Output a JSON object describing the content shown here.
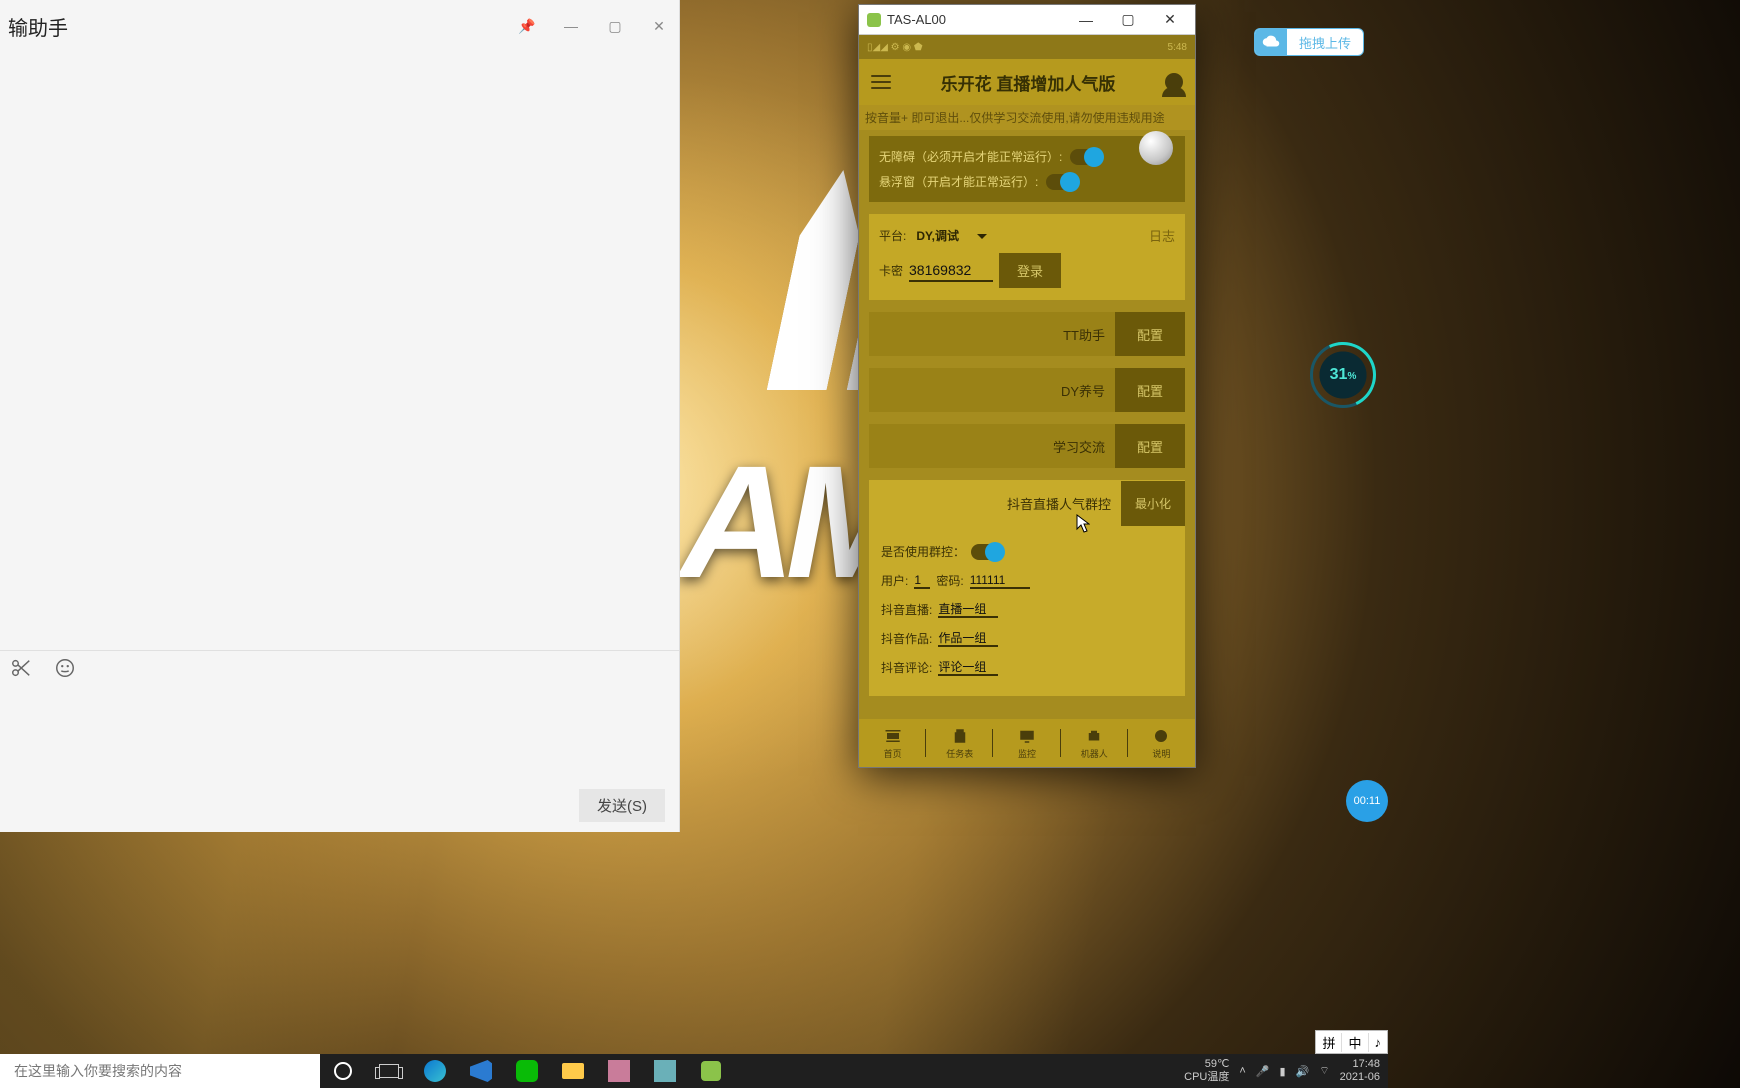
{
  "chat": {
    "title": "输助手",
    "send": "发送(S)"
  },
  "emu": {
    "title": "TAS-AL00",
    "status_time": "5:48",
    "app_title": "乐开花 直播增加人气版",
    "marquee": "按音量+ 即可退出...仅供学习交流使用,请勿使用违规用途",
    "toggle_accessibility": "无障碍（必须开启才能正常运行）:",
    "toggle_float": "悬浮窗（开启才能正常运行）:",
    "platform_label": "平台:",
    "platform_value": "DY,调试",
    "log_link": "日志",
    "card_label": "卡密",
    "card_value": "38169832",
    "login_btn": "登录",
    "rows": [
      {
        "label": "TT助手",
        "btn": "配置"
      },
      {
        "label": "DY养号",
        "btn": "配置"
      },
      {
        "label": "学习交流",
        "btn": "配置"
      }
    ],
    "section_title": "抖音直播人气群控",
    "minimize": "最小化",
    "use_group_label": "是否使用群控：",
    "user_label": "用户:",
    "user_value": "1",
    "pass_label": "密码:",
    "pass_value": "111111",
    "dy_live_label": "抖音直播:",
    "dy_live_value": "直播一组",
    "dy_works_label": "抖音作品:",
    "dy_works_value": "作品一组",
    "dy_comment_label": "抖音评论:",
    "dy_comment_value": "评论一组",
    "tabs": [
      "首页",
      "任务表",
      "监控",
      "机器人",
      "说明"
    ]
  },
  "upload_label": "拖拽上传",
  "cpu_percent": "31",
  "rec_time": "00:11",
  "ime": [
    "拼",
    "中",
    "♪"
  ],
  "taskbar": {
    "search_placeholder": "在这里输入你要搜索的内容",
    "temp": "59℃",
    "temp_label": "CPU温度",
    "time": "17:48",
    "date": "2021-06"
  },
  "desktop_brand": "AMIN"
}
